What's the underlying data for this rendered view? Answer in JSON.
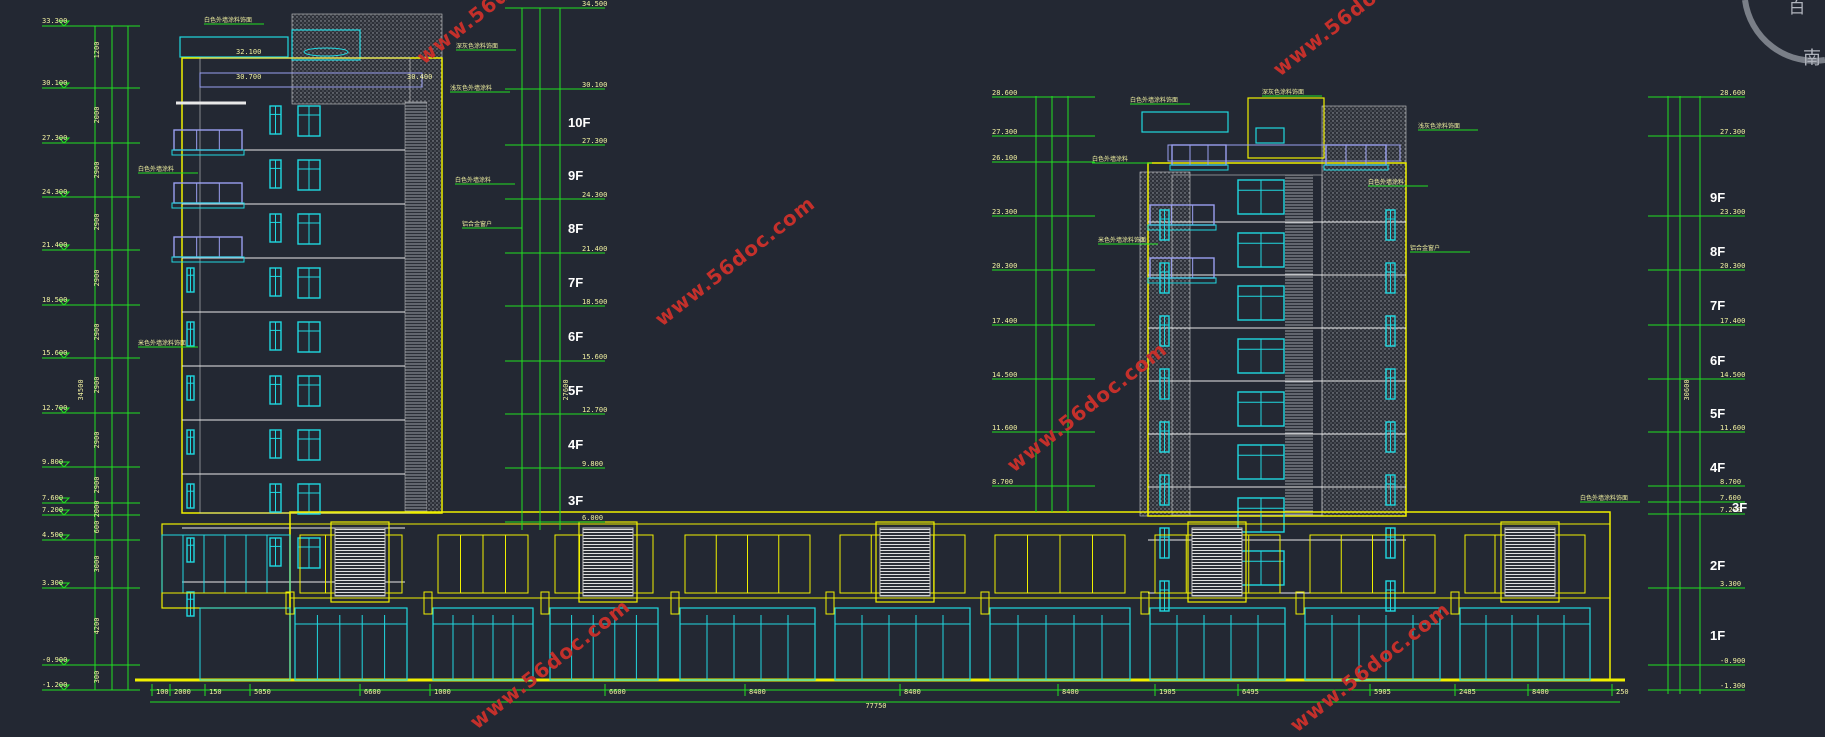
{
  "compass": {
    "top_label": "白",
    "side_label": "南"
  },
  "watermark": "www.56doc.com",
  "left": {
    "elevations": [
      "33.300",
      "30.100",
      "27.300",
      "24.300",
      "21.400",
      "18.500",
      "15.600",
      "12.700",
      "9.800",
      "7.600",
      "7.200",
      "4.500",
      "3.300",
      "-0.900",
      "-1.200"
    ],
    "dims_col1": [
      "1200",
      "2000",
      "2900",
      "2900",
      "2900",
      "2900",
      "2900",
      "2900",
      "2900",
      "2000",
      "600",
      "3000",
      "4200",
      "300"
    ],
    "total": "34500",
    "floors": [
      "10F",
      "9F",
      "8F",
      "7F",
      "6F",
      "5F",
      "4F",
      "3F"
    ],
    "right_levels": [
      "34.500",
      "30.100",
      "27.300",
      "24.300",
      "21.400",
      "18.500",
      "15.600",
      "12.700",
      "9.800",
      "6.000"
    ],
    "right_total": "27600",
    "roof_marks": [
      "32.100",
      "30.700",
      "30.400"
    ]
  },
  "right": {
    "elevations": [
      "28.600",
      "27.300",
      "26.100",
      "23.300",
      "20.300",
      "17.400",
      "14.500",
      "11.600",
      "8.700"
    ],
    "levels_right": [
      "28.600",
      "27.300",
      "23.300",
      "20.300",
      "17.400",
      "14.500",
      "11.600",
      "8.700",
      "7.600",
      "7.200",
      "3.300",
      "-0.900",
      "-1.300"
    ],
    "floors": [
      "9F",
      "8F",
      "7F",
      "6F",
      "5F",
      "4F",
      "3F",
      "2F",
      "1F"
    ],
    "total": "30600"
  },
  "bottom": {
    "segments": [
      "100",
      "2000",
      "150",
      "5050",
      "6600",
      "1000",
      "6600",
      "8400",
      "8400",
      "8400",
      "1905",
      "6495",
      "5905",
      "2485",
      "8400",
      "250"
    ],
    "total": "77750"
  },
  "annotations_left": [
    "白色外墙涂料饰面",
    "深灰色涂料饰面",
    "浅灰色外墙涂料",
    "铝合金窗户",
    "白色外墙涂料",
    "白色外墙涂料",
    "米色外墙涂料饰面"
  ],
  "annotations_right": [
    "白色外墙涂料饰面",
    "深灰色涂料饰面",
    "白色外墙涂料",
    "浅灰色涂料饰面",
    "白色外墙涂料",
    "铝合金窗户",
    "米色外墙涂料饰面",
    "白色外墙涂料饰面"
  ]
}
